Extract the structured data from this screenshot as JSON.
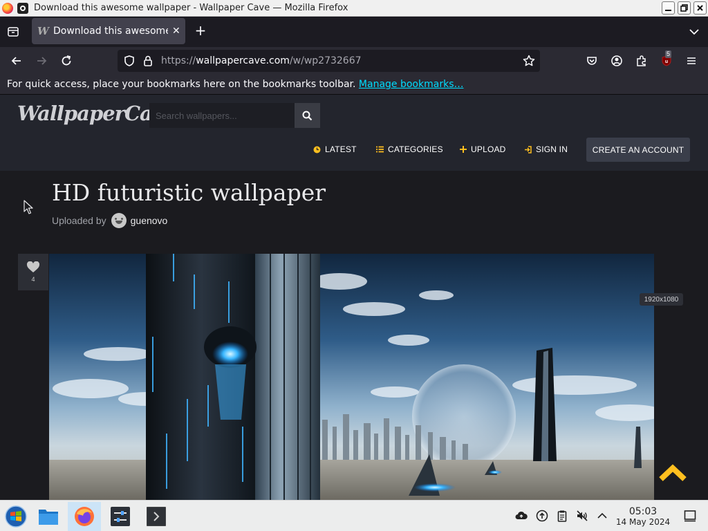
{
  "window": {
    "title": "Download this awesome wallpaper - Wallpaper Cave — Mozilla Firefox"
  },
  "tabs": [
    {
      "label": "Download this awesome wallpaper - Wallpaper Cave",
      "favicon": "W",
      "active": true
    }
  ],
  "navbar": {
    "url_prefix": "https://",
    "url_domain": "wallpapercave.com",
    "url_path": "/w/wp2732667",
    "extension_badge": "5"
  },
  "bookmarks_bar": {
    "message": "For quick access, place your bookmarks here on the bookmarks toolbar. ",
    "link": "Manage bookmarks…"
  },
  "site": {
    "logo": "WallpaperCave",
    "search_placeholder": "Search wallpapers...",
    "menu": {
      "latest": "LATEST",
      "categories": "CATEGORIES",
      "upload": "UPLOAD",
      "sign_in": "SIGN IN",
      "create_account": "CREATE AN ACCOUNT"
    },
    "accent_color": "#ffbf1f"
  },
  "content": {
    "title": "HD futuristic wallpaper",
    "uploaded_by_label": "Uploaded by",
    "uploader": "guenovo",
    "likes": "4",
    "resolution": "1920x1080"
  },
  "taskbar": {
    "time": "05:03",
    "date": "14 May 2024"
  }
}
